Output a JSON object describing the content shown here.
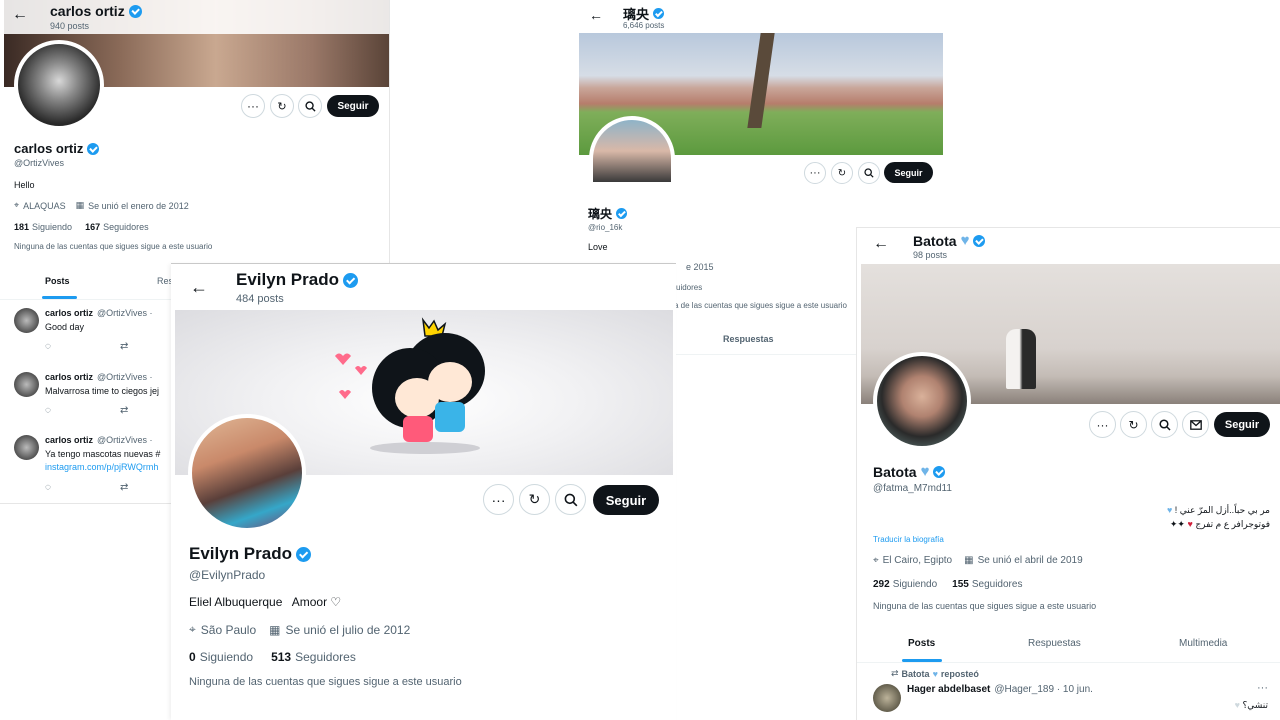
{
  "p1": {
    "name": "carlos ortiz",
    "posts": "940 posts",
    "handle": "@OrtizVives",
    "bio": "Hello",
    "location": "ALAQUAS",
    "joined": "Se unió el enero de 2012",
    "following_count": "181",
    "following_label": "Siguiendo",
    "followers_count": "167",
    "followers_label": "Seguidores",
    "note": "Ninguna de las cuentas que sigues sigue a este usuario",
    "follow": "Seguir",
    "tab_posts": "Posts",
    "tab_replies": "Res",
    "tweets": [
      {
        "name": "carlos ortiz",
        "handle": "@OrtizVives ·",
        "text": "Good day",
        "link": ""
      },
      {
        "name": "carlos ortiz",
        "handle": "@OrtizVives ·",
        "text": "Malvarrosa time to ciegos jej",
        "link": ""
      },
      {
        "name": "carlos ortiz",
        "handle": "@OrtizVives ·",
        "text": "Ya tengo mascotas nuevas #",
        "link": "instagram.com/p/pjRWQrmh"
      }
    ]
  },
  "p2": {
    "name": "璃央",
    "posts": "6,646 posts",
    "handle": "@rio_16k",
    "bio": "Love",
    "joined_partial": "e 2015",
    "followers_partial": "uidores",
    "note_partial": "a de las cuentas que sigues sigue a este usuario",
    "follow": "Seguir",
    "tab_replies": "Respuestas"
  },
  "p3": {
    "name": "Evilyn Prado",
    "posts": "484 posts",
    "handle": "@EvilynPrado",
    "bio": "Eliel Albuquerque   Amoor ♡",
    "location": "São Paulo",
    "joined": "Se unió el julio de 2012",
    "following_count": "0",
    "following_label": "Siguiendo",
    "followers_count": "513",
    "followers_label": "Seguidores",
    "note": "Ninguna de las cuentas que sigues sigue a este usuario",
    "follow": "Seguir"
  },
  "p4": {
    "name": "Batota",
    "posts": "98 posts",
    "handle": "@fatma_M7md11",
    "bio_line1": "مر بي حباً..أزل المرّ عني !",
    "bio_line2": "فوتوجرافر ع م تفرج",
    "translate": "Traducir la biografía",
    "location": "El Cairo, Egipto",
    "joined": "Se unió el abril de 2019",
    "following_count": "292",
    "following_label": "Siguiendo",
    "followers_count": "155",
    "followers_label": "Seguidores",
    "note": "Ninguna de las cuentas que sigues sigue a este usuario",
    "follow": "Seguir",
    "tabs": [
      "Posts",
      "Respuestas",
      "Multimedia"
    ],
    "repost_label": "Batota",
    "repost_suffix": "reposteó",
    "tweet_name": "Hager abdelbaset",
    "tweet_handle": "@Hager_189 · 10 jun.",
    "tweet_text": "تنشي؟"
  },
  "colors": {
    "accent": "#1d9bf0",
    "dark": "#0f1419",
    "muted": "#536471",
    "heart": "#6fb4e8"
  }
}
